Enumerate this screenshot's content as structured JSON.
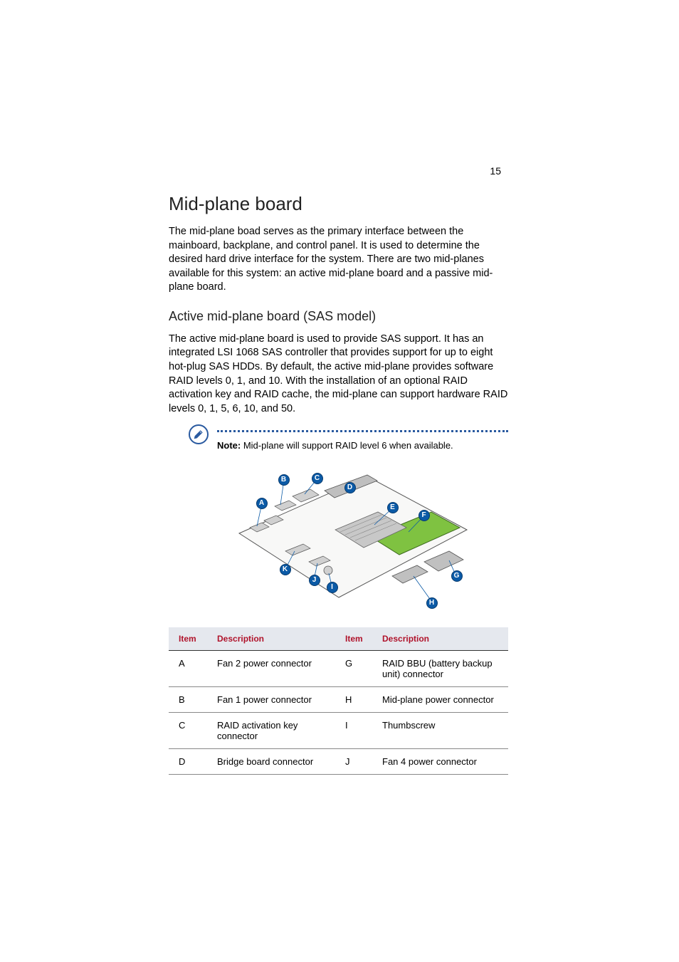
{
  "page_number": "15",
  "heading": "Mid-plane board",
  "intro_para": "The mid-plane boad serves as the primary interface between the mainboard, backplane, and control panel. It is used to determine the desired hard drive interface for the system. There are two mid-planes available for this system: an active mid-plane board and a passive mid-plane board.",
  "subheading": "Active mid-plane board (SAS model)",
  "sub_para": "The active mid-plane board is used to provide SAS support. It has an integrated LSI 1068 SAS controller that provides support for up to eight hot-plug SAS HDDs. By default, the active mid-plane provides software RAID levels 0, 1, and 10. With the installation of an optional RAID activation key and RAID cache, the mid-plane can support hardware RAID levels 0, 1, 5, 6, 10, and 50.",
  "note_label": "Note:",
  "note_text": "Mid-plane will support RAID level 6 when available.",
  "diagram_callouts": [
    "A",
    "B",
    "C",
    "D",
    "E",
    "F",
    "G",
    "H",
    "I",
    "J",
    "K"
  ],
  "table": {
    "headers": [
      "Item",
      "Description",
      "Item",
      "Description"
    ],
    "rows": [
      {
        "c1": "A",
        "c2": "Fan 2 power connector",
        "c3": "G",
        "c4": "RAID BBU (battery backup unit) connector"
      },
      {
        "c1": "B",
        "c2": "Fan 1 power connector",
        "c3": "H",
        "c4": "Mid-plane power connector"
      },
      {
        "c1": "C",
        "c2": "RAID activation key connector",
        "c3": "I",
        "c4": "Thumbscrew"
      },
      {
        "c1": "D",
        "c2": "Bridge board connector",
        "c3": "J",
        "c4": "Fan 4 power connector"
      }
    ]
  }
}
